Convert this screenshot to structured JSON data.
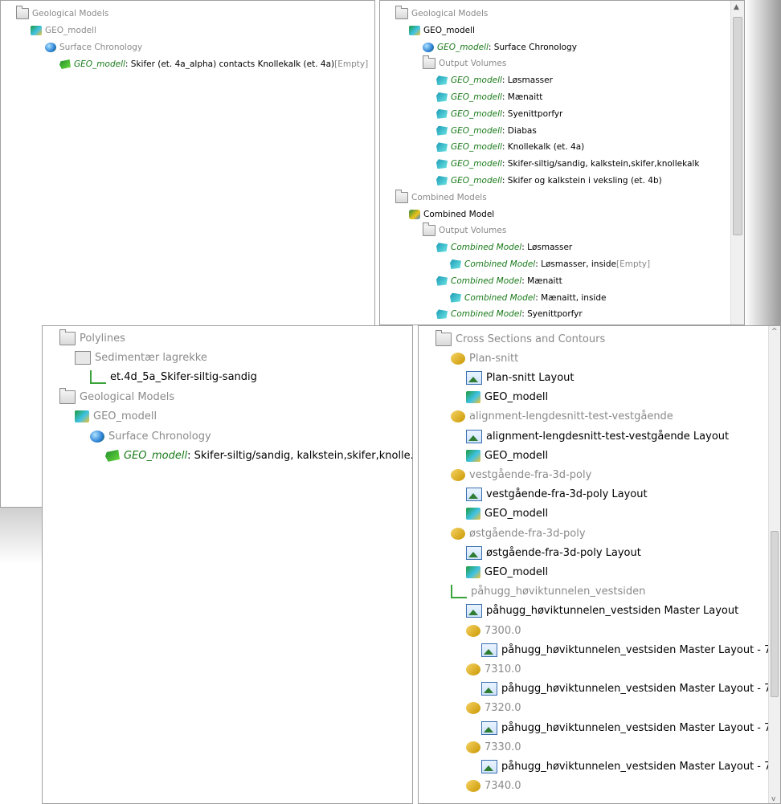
{
  "panel1": {
    "rows": [
      {
        "indent": 0,
        "arrow": "▼",
        "icon": "folder",
        "muted": true,
        "text": "Geological Models"
      },
      {
        "indent": 1,
        "arrow": "▼",
        "icon": "geo",
        "muted": true,
        "text": "GEO_modell"
      },
      {
        "indent": 2,
        "arrow": "▼",
        "icon": "globe",
        "muted": true,
        "text": "Surface Chronology"
      },
      {
        "indent": 3,
        "arrow": "",
        "icon": "surf",
        "prefix": "GEO_modell",
        "text": ": Skifer (et. 4a_alpha) contacts Knollekalk (et. 4a)",
        "suffix": " [Empty]"
      }
    ]
  },
  "panel2": {
    "rows": [
      {
        "indent": 0,
        "arrow": "▼",
        "icon": "folder",
        "muted": true,
        "text": "Geological Models"
      },
      {
        "indent": 1,
        "arrow": "▼",
        "icon": "geo",
        "text": "GEO_modell"
      },
      {
        "indent": 2,
        "arrow": "",
        "icon": "globe",
        "prefix": "GEO_modell",
        "text": ": Surface Chronology"
      },
      {
        "indent": 2,
        "arrow": "▼",
        "icon": "folder",
        "muted": true,
        "text": "Output Volumes"
      },
      {
        "indent": 3,
        "arrow": "",
        "icon": "vol",
        "prefix": "GEO_modell",
        "text": ": Løsmasser"
      },
      {
        "indent": 3,
        "arrow": "",
        "icon": "vol",
        "prefix": "GEO_modell",
        "text": ": Mænaitt"
      },
      {
        "indent": 3,
        "arrow": "",
        "icon": "vol",
        "prefix": "GEO_modell",
        "text": ": Syenittporfyr"
      },
      {
        "indent": 3,
        "arrow": "",
        "icon": "vol",
        "prefix": "GEO_modell",
        "text": ": Diabas"
      },
      {
        "indent": 3,
        "arrow": "",
        "icon": "vol",
        "prefix": "GEO_modell",
        "text": ": Knollekalk (et. 4a)"
      },
      {
        "indent": 3,
        "arrow": "",
        "icon": "vol",
        "prefix": "GEO_modell",
        "text": ": Skifer-siltig/sandig, kalkstein,skifer,knollekalk"
      },
      {
        "indent": 3,
        "arrow": "",
        "icon": "vol",
        "prefix": "GEO_modell",
        "text": ": Skifer og kalkstein i veksling (et. 4b)"
      },
      {
        "indent": 0,
        "arrow": "▼",
        "icon": "folder",
        "muted": true,
        "text": "Combined Models"
      },
      {
        "indent": 1,
        "arrow": "▼",
        "icon": "comb",
        "text": "Combined Model"
      },
      {
        "indent": 2,
        "arrow": "▼",
        "icon": "folder",
        "muted": true,
        "text": "Output Volumes"
      },
      {
        "indent": 3,
        "arrow": "▼",
        "icon": "vol",
        "prefix": "Combined Model",
        "text": ": Løsmasser"
      },
      {
        "indent": 4,
        "arrow": "",
        "icon": "vol",
        "prefix": "Combined Model",
        "text": ": Løsmasser, inside",
        "suffix": " [Empty]"
      },
      {
        "indent": 3,
        "arrow": "▼",
        "icon": "vol",
        "prefix": "Combined Model",
        "text": ": Mænaitt"
      },
      {
        "indent": 4,
        "arrow": "",
        "icon": "vol",
        "prefix": "Combined Model",
        "text": ": Mænaitt, inside"
      },
      {
        "indent": 3,
        "arrow": "▼",
        "icon": "vol",
        "prefix": "Combined Model",
        "text": ": Syenittporfyr"
      }
    ]
  },
  "panel3": {
    "rows": [
      {
        "indent": 0,
        "arrow": "▼",
        "icon": "folder",
        "muted": true,
        "text": "Polylines"
      },
      {
        "indent": 1,
        "arrow": "▼",
        "icon": "sed",
        "muted": true,
        "text": "Sedimentær lagrekke"
      },
      {
        "indent": 2,
        "arrow": "",
        "icon": "poly",
        "text": "et.4d_5a_Skifer-siltig-sandig"
      },
      {
        "indent": 0,
        "arrow": "▼",
        "icon": "folder",
        "muted": true,
        "text": "Geological Models"
      },
      {
        "indent": 1,
        "arrow": "▼",
        "icon": "geo",
        "muted": true,
        "text": "GEO_modell"
      },
      {
        "indent": 2,
        "arrow": "▼",
        "icon": "globe",
        "muted": true,
        "text": "Surface Chronology"
      },
      {
        "indent": 3,
        "arrow": "",
        "icon": "surf",
        "prefix": "GEO_modell",
        "text": ": Skifer-siltig/sandig, kalkstein,skifer,knolle..."
      }
    ]
  },
  "panel4": {
    "rows": [
      {
        "indent": 0,
        "arrow": "▼",
        "icon": "folder",
        "muted": true,
        "text": "Cross Sections and Contours"
      },
      {
        "indent": 1,
        "arrow": "▼",
        "icon": "xsec",
        "muted": true,
        "text": "Plan-snitt"
      },
      {
        "indent": 2,
        "arrow": "",
        "icon": "layout",
        "text": "Plan-snitt Layout"
      },
      {
        "indent": 2,
        "arrow": "",
        "icon": "geo",
        "text": "GEO_modell"
      },
      {
        "indent": 1,
        "arrow": "▼",
        "icon": "xsec",
        "muted": true,
        "text": "alignment-lengdesnitt-test-vestgående"
      },
      {
        "indent": 2,
        "arrow": "",
        "icon": "layout",
        "text": "alignment-lengdesnitt-test-vestgående Layout"
      },
      {
        "indent": 2,
        "arrow": "",
        "icon": "geo",
        "text": "GEO_modell"
      },
      {
        "indent": 1,
        "arrow": "▼",
        "icon": "xsec",
        "muted": true,
        "text": "vestgående-fra-3d-poly"
      },
      {
        "indent": 2,
        "arrow": "",
        "icon": "layout",
        "text": "vestgående-fra-3d-poly Layout"
      },
      {
        "indent": 2,
        "arrow": "",
        "icon": "geo",
        "text": "GEO_modell"
      },
      {
        "indent": 1,
        "arrow": "▼",
        "icon": "xsec",
        "muted": true,
        "text": "østgående-fra-3d-poly"
      },
      {
        "indent": 2,
        "arrow": "",
        "icon": "layout",
        "text": "østgående-fra-3d-poly Layout"
      },
      {
        "indent": 2,
        "arrow": "",
        "icon": "geo",
        "text": "GEO_modell"
      },
      {
        "indent": 1,
        "arrow": "▼",
        "icon": "poly",
        "muted": true,
        "text": "påhugg_høviktunnelen_vestsiden"
      },
      {
        "indent": 2,
        "arrow": "",
        "icon": "layout",
        "text": "påhugg_høviktunnelen_vestsiden Master Layout"
      },
      {
        "indent": 2,
        "arrow": "▼",
        "icon": "xsec",
        "muted": true,
        "text": "7300.0"
      },
      {
        "indent": 3,
        "arrow": "",
        "icon": "layout",
        "text": "påhugg_høviktunnelen_vestsiden Master Layout - 7..."
      },
      {
        "indent": 2,
        "arrow": "▼",
        "icon": "xsec",
        "muted": true,
        "text": "7310.0"
      },
      {
        "indent": 3,
        "arrow": "",
        "icon": "layout",
        "text": "påhugg_høviktunnelen_vestsiden Master Layout - 7..."
      },
      {
        "indent": 2,
        "arrow": "▼",
        "icon": "xsec",
        "muted": true,
        "text": "7320.0"
      },
      {
        "indent": 3,
        "arrow": "",
        "icon": "layout",
        "text": "påhugg_høviktunnelen_vestsiden Master Layout - 7..."
      },
      {
        "indent": 2,
        "arrow": "▼",
        "icon": "xsec",
        "muted": true,
        "text": "7330.0"
      },
      {
        "indent": 3,
        "arrow": "",
        "icon": "layout",
        "text": "påhugg_høviktunnelen_vestsiden Master Layout - 7..."
      },
      {
        "indent": 2,
        "arrow": "▼",
        "icon": "xsec",
        "muted": true,
        "text": "7340.0"
      }
    ]
  }
}
